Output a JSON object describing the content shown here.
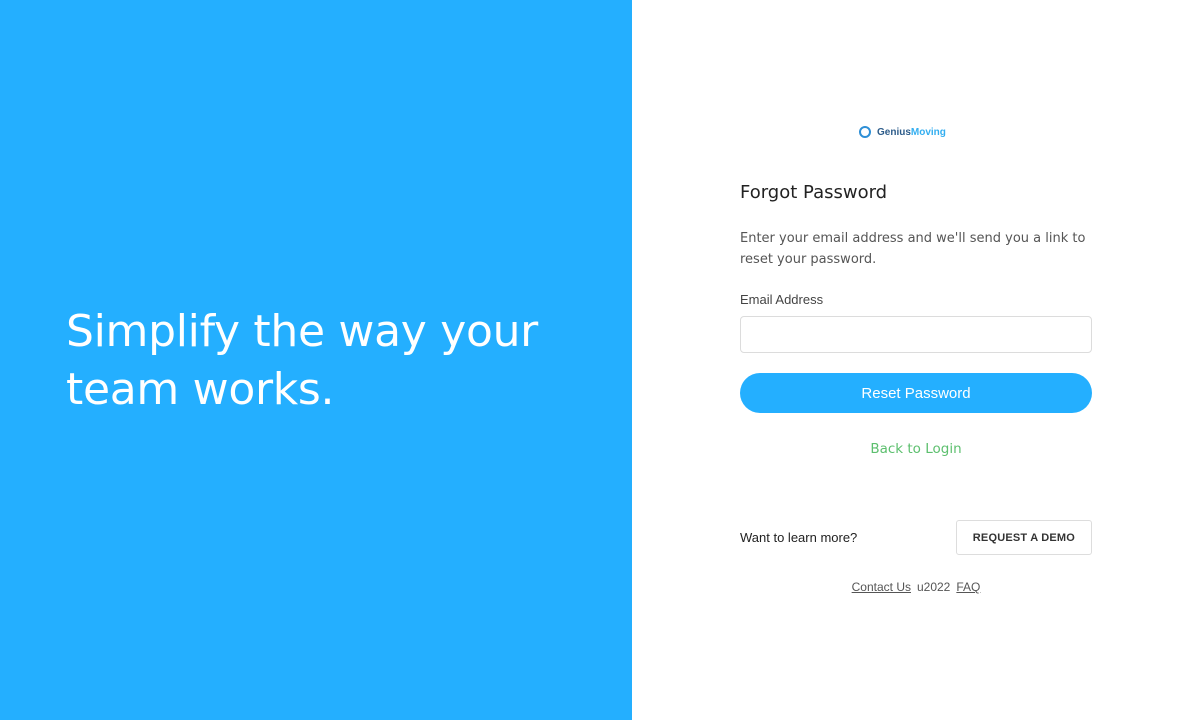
{
  "hero": {
    "headline": "Simplify the way your team works."
  },
  "logo": {
    "icon": "ring-icon",
    "part1": "Genius",
    "part2": "Moving"
  },
  "form": {
    "title": "Forgot Password",
    "description": "Enter your email address and we'll send you a link to reset your password.",
    "email_label": "Email Address",
    "email_value": "",
    "email_placeholder": "",
    "submit_label": "Reset Password",
    "back_link": "Back to Login"
  },
  "learn_more": {
    "text": "Want to learn more?",
    "button_label": "REQUEST A DEMO"
  },
  "footer": {
    "contact": "Contact Us",
    "copyright": "u2022",
    "faq": "FAQ"
  },
  "colors": {
    "brand_blue": "#24afff",
    "link_green": "#5cbf6e"
  }
}
